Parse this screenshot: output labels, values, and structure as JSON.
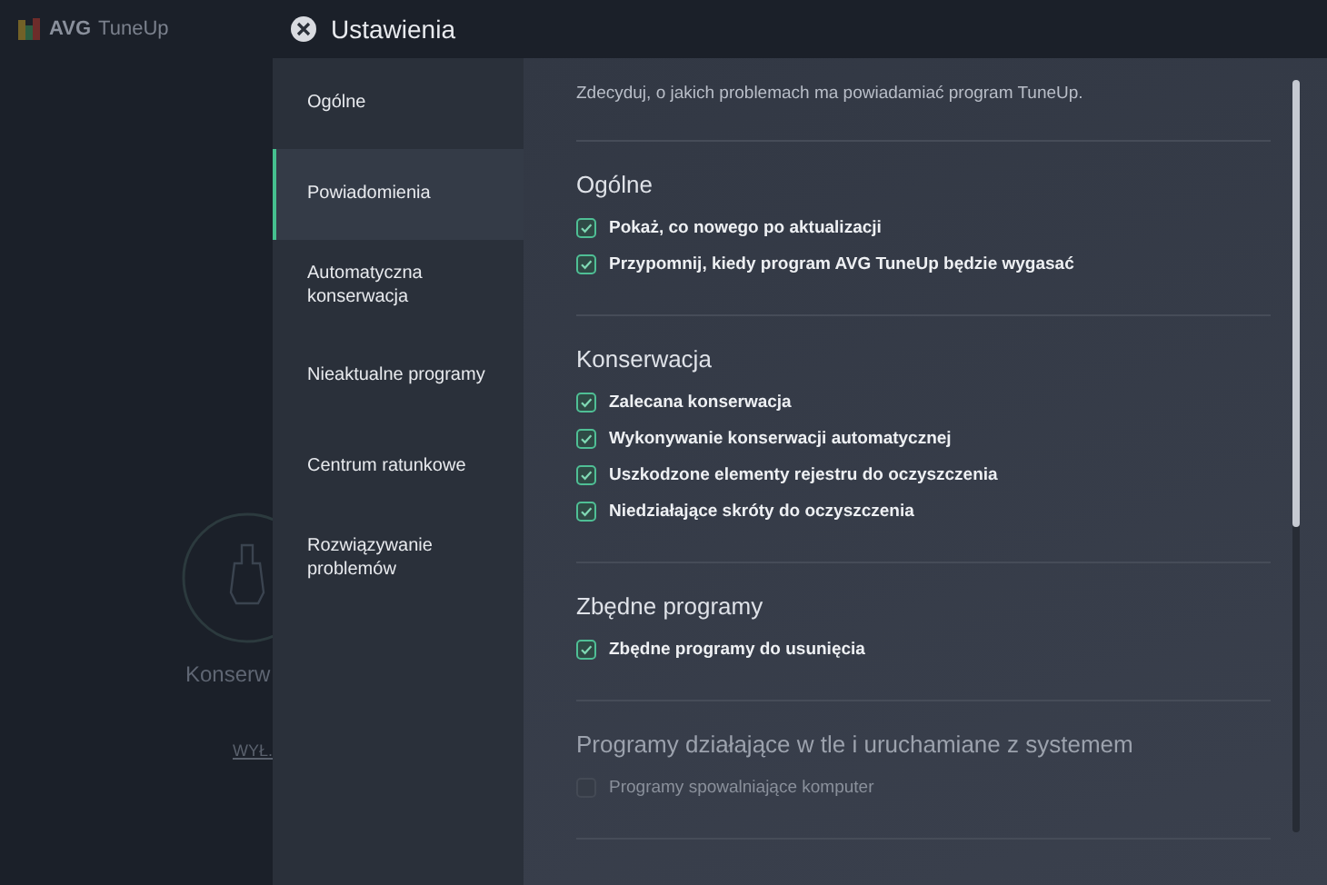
{
  "background_app": {
    "logo": {
      "brand": "AVG",
      "product": "TuneUp"
    },
    "card": {
      "title": "Konserw",
      "lines": [
        "WYŁ."
      ]
    }
  },
  "window": {
    "title": "Ustawienia"
  },
  "sidebar": {
    "items": [
      {
        "label": "Ogólne",
        "selected": false
      },
      {
        "label": "Powiadomienia",
        "selected": true
      },
      {
        "label": "Automatyczna konserwacja",
        "selected": false
      },
      {
        "label": "Nieaktualne programy",
        "selected": false
      },
      {
        "label": "Centrum ratunkowe",
        "selected": false
      },
      {
        "label": "Rozwiązywanie problemów",
        "selected": false
      }
    ]
  },
  "description": "Zdecyduj, o jakich problemach ma powiadamiać program TuneUp.",
  "sections": [
    {
      "title": "Ogólne",
      "disabled": false,
      "options": [
        {
          "label": "Pokaż, co nowego po aktualizacji",
          "checked": true
        },
        {
          "label": "Przypomnij, kiedy program AVG TuneUp będzie wygasać",
          "checked": true
        }
      ]
    },
    {
      "title": "Konserwacja",
      "disabled": false,
      "options": [
        {
          "label": "Zalecana konserwacja",
          "checked": true
        },
        {
          "label": "Wykonywanie konserwacji automatycznej",
          "checked": true
        },
        {
          "label": "Uszkodzone elementy rejestru do oczyszczenia",
          "checked": true
        },
        {
          "label": "Niedziałające skróty do oczyszczenia",
          "checked": true
        }
      ]
    },
    {
      "title": "Zbędne programy",
      "disabled": false,
      "options": [
        {
          "label": "Zbędne programy do usunięcia",
          "checked": true
        }
      ]
    },
    {
      "title": "Programy działające w tle i uruchamiane z systemem",
      "disabled": true,
      "options": [
        {
          "label": "Programy spowalniające komputer",
          "checked": false
        }
      ]
    }
  ]
}
